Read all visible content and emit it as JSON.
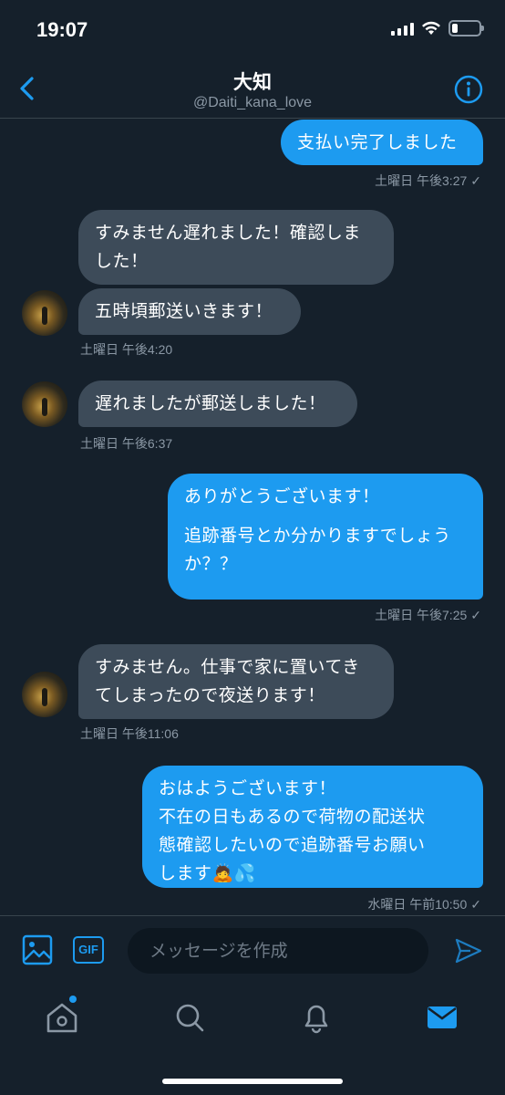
{
  "status_bar": {
    "time": "19:07"
  },
  "header": {
    "title": "大知",
    "handle": "@Daiti_kana_love"
  },
  "messages": {
    "m1": {
      "text": "支払い完了しました",
      "timestamp": "土曜日 午後3:27",
      "check": "✓"
    },
    "m2a": {
      "lines": [
        "すみません遅れました！確認しま",
        "した！"
      ]
    },
    "m2b": {
      "text": "五時頃郵送いきます！",
      "timestamp": "土曜日 午後4:20"
    },
    "m3": {
      "text": "遅れましたが郵送しました！",
      "timestamp": "土曜日 午後6:37"
    },
    "m4": {
      "lines": [
        "ありがとうございます！",
        "",
        "追跡番号とか分かりますでしょう",
        "か？？"
      ],
      "timestamp": "土曜日 午後7:25",
      "check": "✓"
    },
    "m5": {
      "lines": [
        "すみません。仕事で家に置いてき",
        "てしまったので夜送ります！"
      ],
      "timestamp": "土曜日 午後11:06"
    },
    "m6": {
      "lines": [
        "おはようございます！",
        "不在の日もあるので荷物の配送状",
        "態確認したいので追跡番号お願い",
        "します🙇💦"
      ],
      "timestamp": "水曜日 午前10:50",
      "check": "✓"
    }
  },
  "composer": {
    "gif_label": "GIF",
    "placeholder": "メッセージを作成"
  },
  "tabbar": {
    "items": [
      "home",
      "search",
      "notifications",
      "messages"
    ]
  },
  "colors": {
    "background": "#15202b",
    "accent": "#1d9bf0",
    "incoming_bubble": "#3d4b59",
    "muted_text": "#8b98a5"
  }
}
